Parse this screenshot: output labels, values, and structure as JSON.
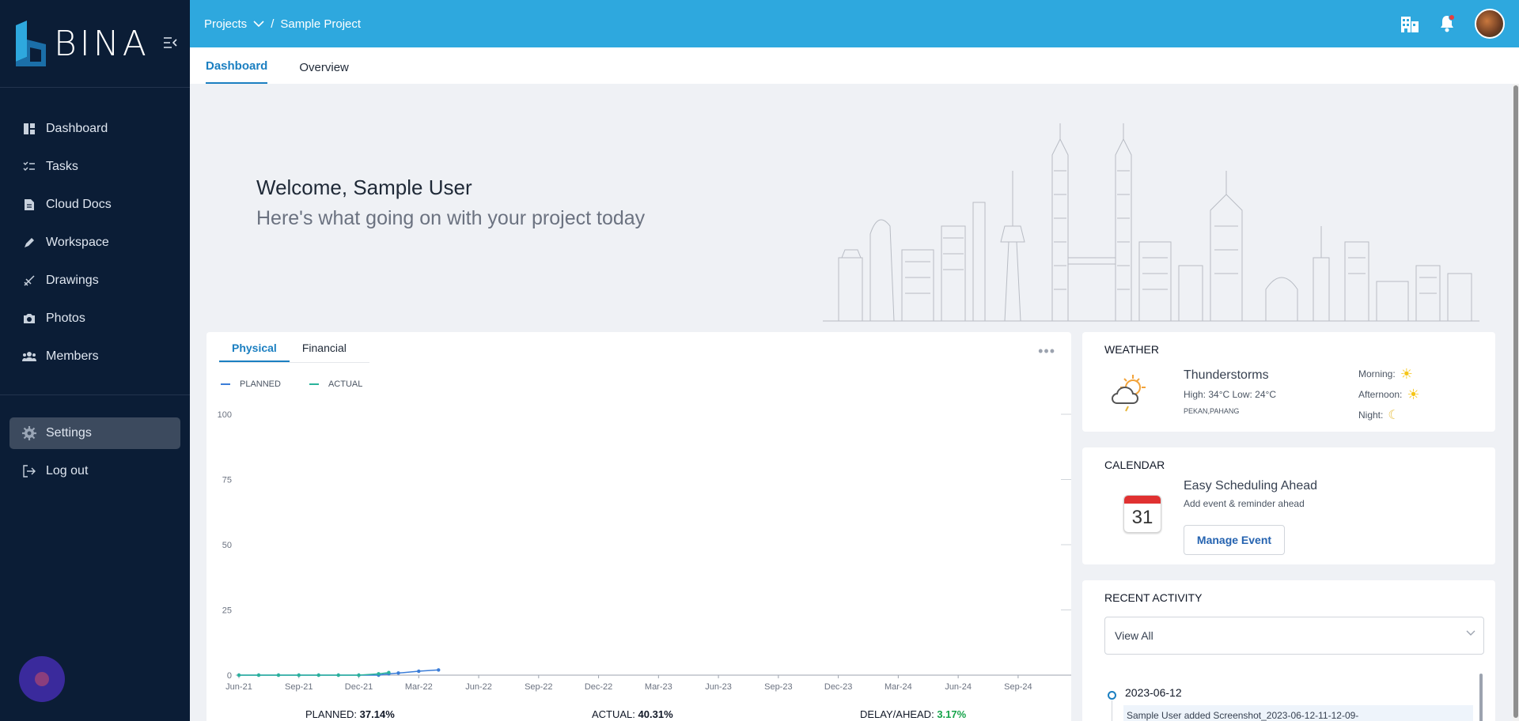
{
  "brand": {
    "name": "BINA"
  },
  "sidebar": {
    "items": [
      {
        "label": "Dashboard",
        "icon": "dashboard-icon"
      },
      {
        "label": "Tasks",
        "icon": "tasks-icon"
      },
      {
        "label": "Cloud Docs",
        "icon": "document-icon"
      },
      {
        "label": "Workspace",
        "icon": "pen-icon"
      },
      {
        "label": "Drawings",
        "icon": "drawing-icon"
      },
      {
        "label": "Photos",
        "icon": "camera-icon"
      },
      {
        "label": "Members",
        "icon": "members-icon"
      }
    ],
    "settings": "Settings",
    "logout": "Log out"
  },
  "header": {
    "projects": "Projects",
    "separator": "/",
    "project": "Sample Project"
  },
  "tabs": [
    "Dashboard",
    "Overview"
  ],
  "hero": {
    "welcome": "Welcome, Sample User",
    "subtitle": "Here's what going on with your project today"
  },
  "progress": {
    "tabs": [
      "Physical",
      "Financial"
    ],
    "legend": {
      "planned": "PLANNED",
      "actual": "ACTUAL"
    },
    "summary": {
      "planned_label": "PLANNED:",
      "planned_value": "37.14%",
      "actual_label": "ACTUAL:",
      "actual_value": "40.31%",
      "delay_label": "DELAY/AHEAD:",
      "delay_value": "3.17%"
    }
  },
  "chart_data": {
    "type": "line",
    "categories": [
      "Jun-21",
      "Sep-21",
      "Dec-21",
      "Mar-22",
      "Jun-22",
      "Sep-22",
      "Dec-22",
      "Mar-23",
      "Jun-23",
      "Sep-23",
      "Dec-23",
      "Mar-24",
      "Jun-24",
      "Sep-24"
    ],
    "ylim": [
      0,
      100
    ],
    "yticks": [
      0,
      25,
      50,
      75,
      100
    ],
    "series": [
      {
        "name": "PLANNED",
        "color": "#3b7dd8",
        "points": [
          [
            0.0,
            0
          ],
          [
            0.33,
            0
          ],
          [
            0.66,
            0
          ],
          [
            1.0,
            0
          ],
          [
            1.33,
            0
          ],
          [
            1.66,
            0
          ],
          [
            2.0,
            0
          ],
          [
            2.33,
            0
          ],
          [
            2.5,
            0.5
          ],
          [
            2.66,
            0.8
          ],
          [
            3.0,
            1.5
          ],
          [
            3.33,
            2
          ]
        ]
      },
      {
        "name": "ACTUAL",
        "color": "#2bb39b",
        "points": [
          [
            0.0,
            0
          ],
          [
            0.33,
            0
          ],
          [
            0.66,
            0
          ],
          [
            1.0,
            0
          ],
          [
            1.33,
            0
          ],
          [
            1.66,
            0
          ],
          [
            2.0,
            0
          ],
          [
            2.33,
            0.5
          ],
          [
            2.5,
            1.0
          ]
        ]
      }
    ],
    "legend": "top-left"
  },
  "weather": {
    "title": "WEATHER",
    "condition": "Thunderstorms",
    "high_low": "High: 34°C Low: 24°C",
    "location": "PEKAN,PAHANG",
    "parts": [
      {
        "label": "Morning:",
        "icon": "sun-icon"
      },
      {
        "label": "Afternoon:",
        "icon": "sun-icon"
      },
      {
        "label": "Night:",
        "icon": "moon-icon"
      }
    ]
  },
  "calendar": {
    "title": "CALENDAR",
    "heading": "Easy Scheduling Ahead",
    "sub": "Add event & reminder ahead",
    "day": "31",
    "button": "Manage Event"
  },
  "activity": {
    "title": "RECENT ACTIVITY",
    "filter": "View All",
    "date": "2023-06-12",
    "item": "Sample User added Screenshot_2023-06-12-11-12-09-"
  }
}
